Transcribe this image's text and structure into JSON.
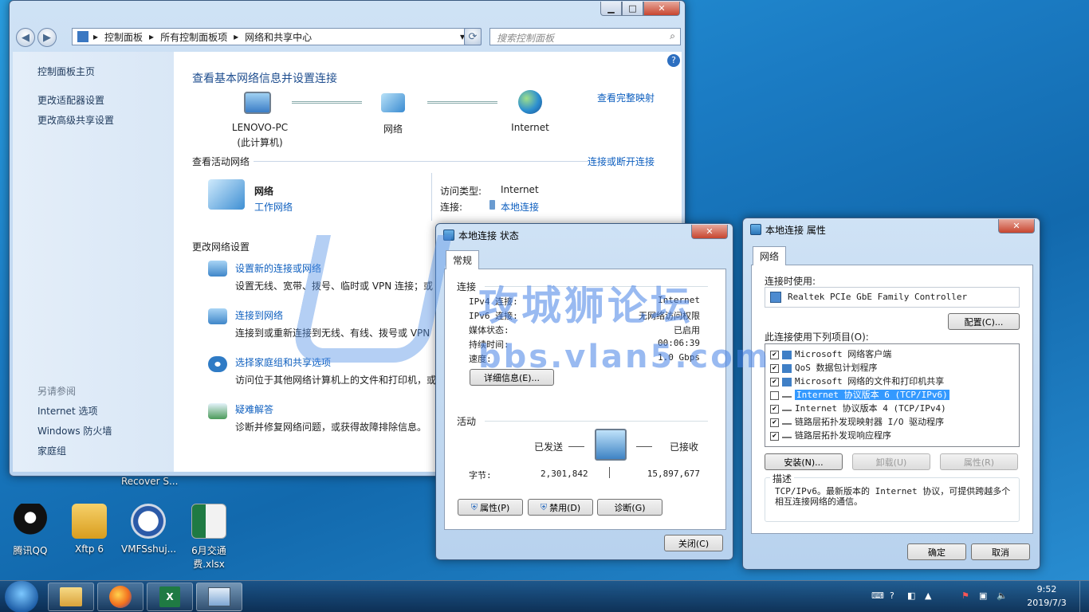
{
  "desktop": {
    "icons": [
      {
        "label": "腾讯QQ",
        "icon": "qq-penguin-icon"
      },
      {
        "label": "Xftp 6",
        "icon": "xftp-folder-icon"
      },
      {
        "label": "VMFSshuj...",
        "icon": "zip-archive-icon"
      },
      {
        "label": "6月交通费.xlsx",
        "icon": "excel-file-icon"
      }
    ],
    "partial_label": "Recover S..."
  },
  "main_window": {
    "breadcrumb": [
      "控制面板",
      "所有控制面板项",
      "网络和共享中心"
    ],
    "search_placeholder": "搜索控制面板",
    "sidebar": {
      "top_links": [
        "控制面板主页",
        "更改适配器设置",
        "更改高级共享设置"
      ],
      "see_also_heading": "另请参阅",
      "see_also_links": [
        "Internet 选项",
        "Windows 防火墙",
        "家庭组"
      ]
    },
    "heading": "查看基本网络信息并设置连接",
    "view_full_map": "查看完整映射",
    "map": {
      "computer_name": "LENOVO-PC",
      "computer_sub": "(此计算机)",
      "network": "网络",
      "internet": "Internet"
    },
    "active_networks_label": "查看活动网络",
    "connect_disconnect": "连接或断开连接",
    "active_network": {
      "name": "网络",
      "type": "工作网络",
      "access_type_label": "访问类型:",
      "access_type_value": "Internet",
      "connection_label": "连接:",
      "connection_value": "本地连接"
    },
    "change_settings_label": "更改网络设置",
    "tasks": [
      {
        "title": "设置新的连接或网络",
        "desc": "设置无线、宽带、拨号、临时或 VPN 连接；或"
      },
      {
        "title": "连接到网络",
        "desc": "连接到或重新连接到无线、有线、拨号或 VPN"
      },
      {
        "title": "选择家庭组和共享选项",
        "desc": "访问位于其他网络计算机上的文件和打印机，或"
      },
      {
        "title": "疑难解答",
        "desc": "诊断并修复网络问题，或获得故障排除信息。"
      }
    ]
  },
  "status_dialog": {
    "title": "本地连接 状态",
    "tab": "常规",
    "connection_section": "连接",
    "rows": [
      {
        "label": "IPv4 连接:",
        "value": "Internet"
      },
      {
        "label": "IPv6 连接:",
        "value": "无网络访问权限"
      },
      {
        "label": "媒体状态:",
        "value": "已启用"
      },
      {
        "label": "持续时间:",
        "value": "00:06:39"
      },
      {
        "label": "速度:",
        "value": "1.0 Gbps"
      }
    ],
    "details_button": "详细信息(E)...",
    "activity_section": "活动",
    "sent_label": "已发送",
    "received_label": "已接收",
    "bytes_label": "字节:",
    "bytes_sent": "2,301,842",
    "bytes_received": "15,897,677",
    "buttons": {
      "properties": "属性(P)",
      "disable": "禁用(D)",
      "diagnose": "诊断(G)",
      "close": "关闭(C)"
    }
  },
  "props_dialog": {
    "title": "本地连接 属性",
    "tab": "网络",
    "connect_using_label": "连接时使用:",
    "adapter": "Realtek PCIe GbE Family Controller",
    "configure_button": "配置(C)...",
    "items_label": "此连接使用下列项目(O):",
    "items": [
      {
        "checked": "✔",
        "label": "Microsoft 网络客户端"
      },
      {
        "checked": "✔",
        "label": "QoS 数据包计划程序"
      },
      {
        "checked": "✔",
        "label": "Microsoft 网络的文件和打印机共享"
      },
      {
        "checked": "",
        "label": "Internet 协议版本 6 (TCP/IPv6)"
      },
      {
        "checked": "✔",
        "label": "Internet 协议版本 4 (TCP/IPv4)"
      },
      {
        "checked": "✔",
        "label": "链路层拓扑发现映射器 I/O 驱动程序"
      },
      {
        "checked": "✔",
        "label": "链路层拓扑发现响应程序"
      }
    ],
    "install_button": "安装(N)...",
    "uninstall_button": "卸载(U)",
    "properties_button": "属性(R)",
    "description_label": "描述",
    "description": "TCP/IPv6。最新版本的 Internet 协议，可提供跨越多个相互连接网络的通信。",
    "ok_button": "确定",
    "cancel_button": "取消"
  },
  "watermark": {
    "text": "攻城狮论坛",
    "url": "bbs.vlan5.com"
  },
  "taskbar": {
    "time": "9:52",
    "date": "2019/7/3",
    "pinned": [
      "explorer-icon",
      "firefox-icon",
      "excel-icon",
      "control-panel-icon"
    ]
  }
}
